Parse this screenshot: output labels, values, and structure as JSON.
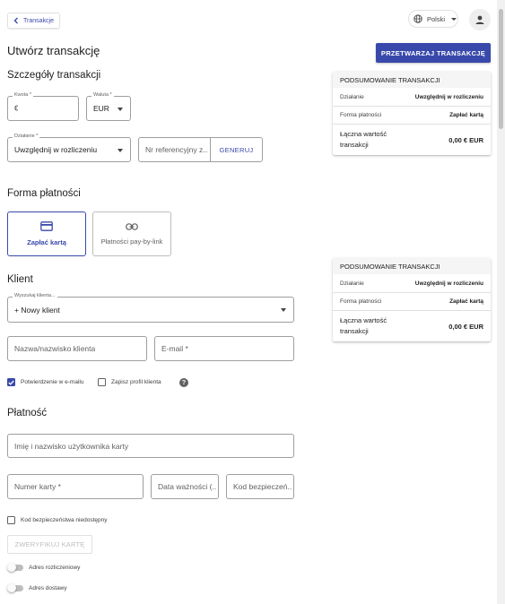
{
  "header": {
    "back_label": "Transakcje",
    "language": "Polski"
  },
  "page": {
    "title": "Utwórz transakcję",
    "process_button": "PRZETWARZAJ TRANSAKCJĘ"
  },
  "details": {
    "title": "Szczegóły transakcji",
    "amount": {
      "label": "Kwota *",
      "prefix": "€",
      "value": ""
    },
    "currency": {
      "label": "Waluta *",
      "value": "EUR"
    },
    "action": {
      "label": "Działanie *",
      "value": "Uwzględnij w rozliczeniu"
    },
    "reference": {
      "placeholder": "Nr referencyjny z...",
      "generate_label": "GENERUJ"
    }
  },
  "payment_method": {
    "title": "Forma płatności",
    "options": [
      {
        "label": "Zapłać kartą",
        "icon": "credit-card-icon",
        "selected": true
      },
      {
        "label": "Płatności pay-by-link",
        "icon": "link-icon",
        "selected": false
      }
    ]
  },
  "client": {
    "title": "Klient",
    "search": {
      "label": "Wyszukaj klienta...",
      "value": "+ Nowy klient"
    },
    "name_placeholder": "Nazwa/nazwisko klienta",
    "email_placeholder": "E-mail *",
    "email_confirmation": {
      "label": "Potwierdzenie w e-mailu",
      "checked": true
    },
    "save_profile": {
      "label": "Zapisz profil klienta",
      "checked": false
    }
  },
  "payment": {
    "title": "Płatność",
    "cardholder_placeholder": "Imię i nazwisko użytkownika karty",
    "card_number_placeholder": "Numer karty *",
    "expiry_placeholder": "Data ważności (...",
    "cvv_placeholder": "Kod bezpieczeń...",
    "cvv_unavailable": {
      "label": "Kod bezpieczeństwa niedostępny",
      "checked": false
    },
    "verify_button": "ZWERYFIKUJ KARTĘ",
    "billing_address": {
      "label": "Adres rozliczeniowy",
      "on": false
    },
    "shipping_address": {
      "label": "Adres dostawy",
      "on": false
    }
  },
  "summaries": [
    {
      "title": "PODSUMOWANIE TRANSAKCJI",
      "action_label": "Działanie",
      "action_value": "Uwzględnij w rozliczeniu",
      "method_label": "Forma płatności",
      "method_value": "Zapłać kartą",
      "total_label": "Łączna wartość transakcji",
      "total_value": "0,00 € EUR"
    },
    {
      "title": "PODSUMOWANIE TRANSAKCJI",
      "action_label": "Działanie",
      "action_value": "Uwzględnij w rozliczeniu",
      "method_label": "Forma płatności",
      "method_value": "Zapłać kartą",
      "total_label": "Łączna wartość transakcji",
      "total_value": "0,00 € EUR"
    }
  ],
  "colors": {
    "primary": "#3949ab",
    "border": "#9e9e9e",
    "summary_header_bg": "#f5f5f5"
  }
}
